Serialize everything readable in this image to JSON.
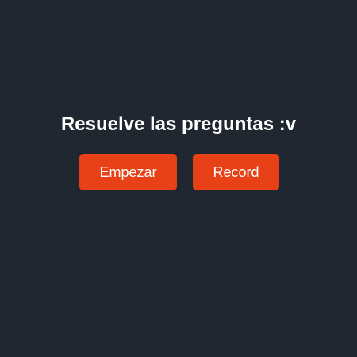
{
  "main": {
    "title": "Resuelve las preguntas :v",
    "buttons": {
      "start_label": "Empezar",
      "record_label": "Record"
    }
  },
  "colors": {
    "background": "#202731",
    "button": "#e84118",
    "text": "#ffffff"
  }
}
